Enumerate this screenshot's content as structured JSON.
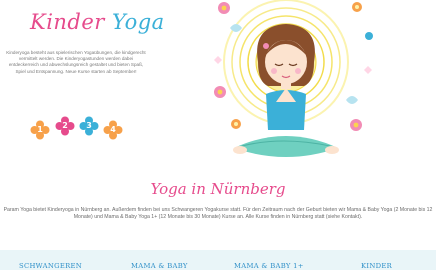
{
  "logo": {
    "part1": "Kinder",
    "part2": "Yoga"
  },
  "intro_text": "Kinderyoga besteht aus spielerischen Yogaübungen, die kindgerecht vermittelt werden. Die Kinderyogastunden werden dabei entdeckerreich und abwechslungsreich gestaltet und bieten Spaß, Spiel und Entspannung. Neue Kurse starten ab September!",
  "flowers": [
    {
      "label": "1",
      "color": "#f7a14a"
    },
    {
      "label": "2",
      "color": "#e64b8c"
    },
    {
      "label": "3",
      "color": "#3bb0d8"
    },
    {
      "label": "4",
      "color": "#f7a14a"
    }
  ],
  "section": {
    "heading": "Yoga in Nürnberg",
    "description": "Param Yoga bietet Kinderyoga in Nürnberg an. Außerdem finden bei uns Schwangeren Yogakurse statt. Für den Zeitraum nach der Geburt bieten wir Mama & Baby Yoga (2 Monate bis 12 Monate) und Mama & Baby Yoga 1+ (12 Monate bis 30 Monate) Kurse an. Alle Kurse finden in Nürnberg statt (siehe Kontakt)."
  },
  "nav": {
    "items": [
      {
        "label": "SCHWANGEREN"
      },
      {
        "label": "MAMA & BABY"
      },
      {
        "label": "MAMA & BABY 1+"
      },
      {
        "label": "KINDER"
      }
    ]
  },
  "colors": {
    "pink": "#e64b8c",
    "blue": "#3bb0d8",
    "orange": "#f7a14a",
    "nav_bg": "#e9f5f8"
  }
}
